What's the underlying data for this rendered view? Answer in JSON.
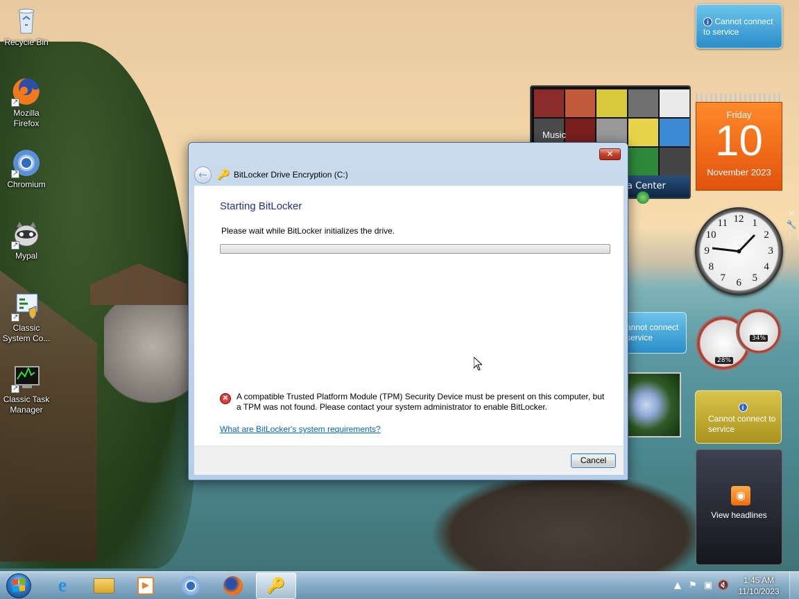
{
  "desktop": {
    "icons": [
      {
        "label": "Recycle Bin",
        "icon": "recycle-bin-icon"
      },
      {
        "label": "Mozilla Firefox",
        "icon": "firefox-icon"
      },
      {
        "label": "Chromium",
        "icon": "chromium-icon"
      },
      {
        "label": "Mypal",
        "icon": "mypal-icon"
      },
      {
        "label": "Classic System Co...",
        "icon": "control-panel-icon"
      },
      {
        "label": "Classic Task Manager",
        "icon": "task-manager-icon"
      }
    ]
  },
  "gadgets": {
    "weather_message": "Cannot connect to service",
    "weather2_message": "annot connect service",
    "currency_message": "Cannot connect to service",
    "media_label": "Music",
    "media_bar_text": "a Center",
    "calendar": {
      "day_of_week": "Friday",
      "day": "10",
      "month_year": "November 2023"
    },
    "clock_numbers": [
      "12",
      "1",
      "2",
      "3",
      "4",
      "5",
      "6",
      "7",
      "8",
      "9",
      "10",
      "11"
    ],
    "cpu_meter": {
      "cpu": "28%",
      "ram": "34%"
    },
    "feeds": {
      "label": "View headlines"
    }
  },
  "dialog": {
    "title": "BitLocker Drive Encryption (C:)",
    "heading": "Starting BitLocker",
    "wait_text": "Please wait while BitLocker initializes the drive.",
    "progress": 0.0,
    "error_text": "A compatible Trusted Platform Module (TPM) Security Device must be present on this computer, but a TPM was not found. Please contact your system administrator to enable BitLocker.",
    "link_text": "What are BitLocker's system requirements?",
    "cancel_label": "Cancel",
    "close_glyph": "✕"
  },
  "taskbar": {
    "pinned": [
      "internet-explorer-icon",
      "explorer-icon",
      "media-player-icon",
      "chromium-icon",
      "firefox-icon",
      "bitlocker-icon"
    ],
    "time": "1:45 AM",
    "date": "11/10/2023"
  },
  "colors": {
    "dialog_heading": "#1e3287",
    "link": "#0066cc",
    "calendar_orange": "#e2520c"
  }
}
